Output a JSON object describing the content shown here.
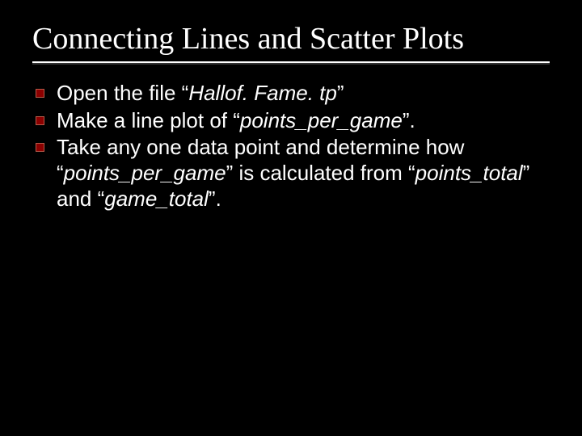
{
  "slide": {
    "title": "Connecting Lines and Scatter Plots",
    "bullets": [
      {
        "pre": "Open the file “",
        "em1": "Hallof. Fame. tp",
        "mid1": "”",
        "em2": "",
        "mid2": "",
        "em3": "",
        "post": ""
      },
      {
        "pre": "Make a line plot of “",
        "em1": "points_per_game",
        "mid1": "”.",
        "em2": "",
        "mid2": "",
        "em3": "",
        "post": ""
      },
      {
        "pre": "Take any one data point and determine how “",
        "em1": "points_per_game",
        "mid1": "” is calculated from “",
        "em2": "points_total",
        "mid2": "” and “",
        "em3": "game_total",
        "post": "”."
      }
    ]
  }
}
